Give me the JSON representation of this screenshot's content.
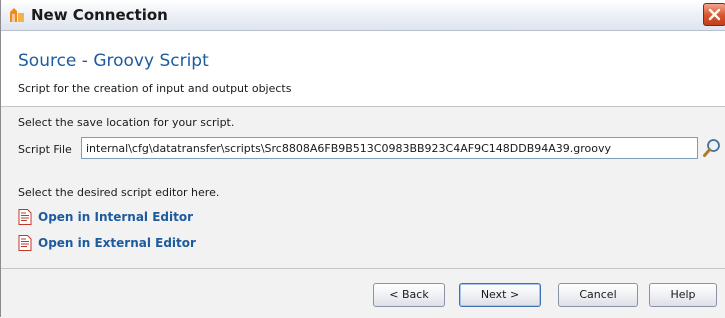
{
  "window": {
    "title": "New Connection",
    "icons": {
      "app": "app-logo-icon",
      "close": "close-icon"
    }
  },
  "header": {
    "title": "Source - Groovy Script",
    "subtitle": "Script for the creation of input and output objects"
  },
  "main": {
    "save_instruction": "Select the save location for your script.",
    "script_file": {
      "label": "Script File",
      "value": "internal\\cfg\\datatransfer\\scripts\\Src8808A6FB9B513C0983BB923C4AF9C148DDB94A39.groovy",
      "browse_icon": "search-icon"
    },
    "editor_instruction": "Select the desired script editor here.",
    "editor_links": [
      {
        "label": "Open in Internal Editor",
        "icon": "script-file-icon"
      },
      {
        "label": "Open in External Editor",
        "icon": "script-file-icon"
      }
    ]
  },
  "footer": {
    "back_label": "< Back",
    "next_label": "Next >",
    "cancel_label": "Cancel",
    "help_label": "Help"
  },
  "colors": {
    "accent_text": "#1d5b9e",
    "panel_background": "#f2f2f2",
    "close_button": "#d9532c"
  }
}
